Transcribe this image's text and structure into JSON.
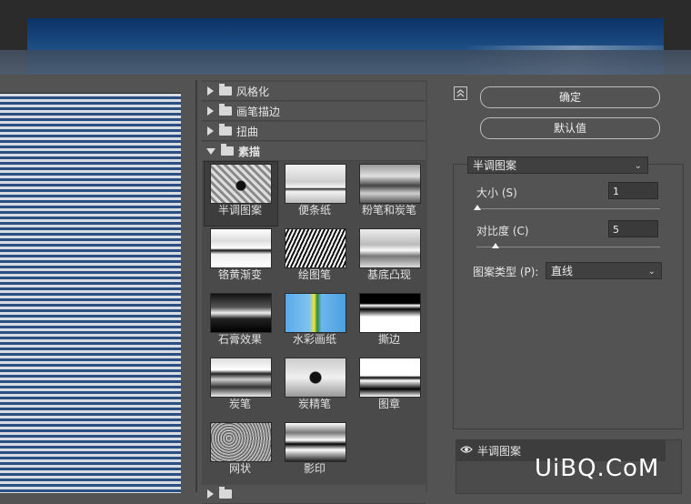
{
  "gallery": {
    "categories": [
      {
        "label": "风格化",
        "expanded": false
      },
      {
        "label": "画笔描边",
        "expanded": false
      },
      {
        "label": "扭曲",
        "expanded": false
      },
      {
        "label": "素描",
        "expanded": true
      }
    ],
    "filters": [
      {
        "label": "半调图案",
        "selected": true
      },
      {
        "label": "便条纸"
      },
      {
        "label": "粉笔和炭笔"
      },
      {
        "label": "铬黄渐变"
      },
      {
        "label": "绘图笔"
      },
      {
        "label": "基底凸现"
      },
      {
        "label": "石膏效果"
      },
      {
        "label": "水彩画纸"
      },
      {
        "label": "撕边"
      },
      {
        "label": "炭笔"
      },
      {
        "label": "炭精笔"
      },
      {
        "label": "图章"
      },
      {
        "label": "网状"
      },
      {
        "label": "影印"
      }
    ]
  },
  "buttons": {
    "ok": "确定",
    "default": "默认值"
  },
  "params": {
    "filter_select": "半调图案",
    "size_label": "大小 (S)",
    "size_value": "1",
    "contrast_label": "对比度 (C)",
    "contrast_value": "5",
    "pattern_type_label": "图案类型 (P):",
    "pattern_type_value": "直线"
  },
  "layers": {
    "item": "半调图案"
  },
  "watermark": "UiBQ.CoM"
}
